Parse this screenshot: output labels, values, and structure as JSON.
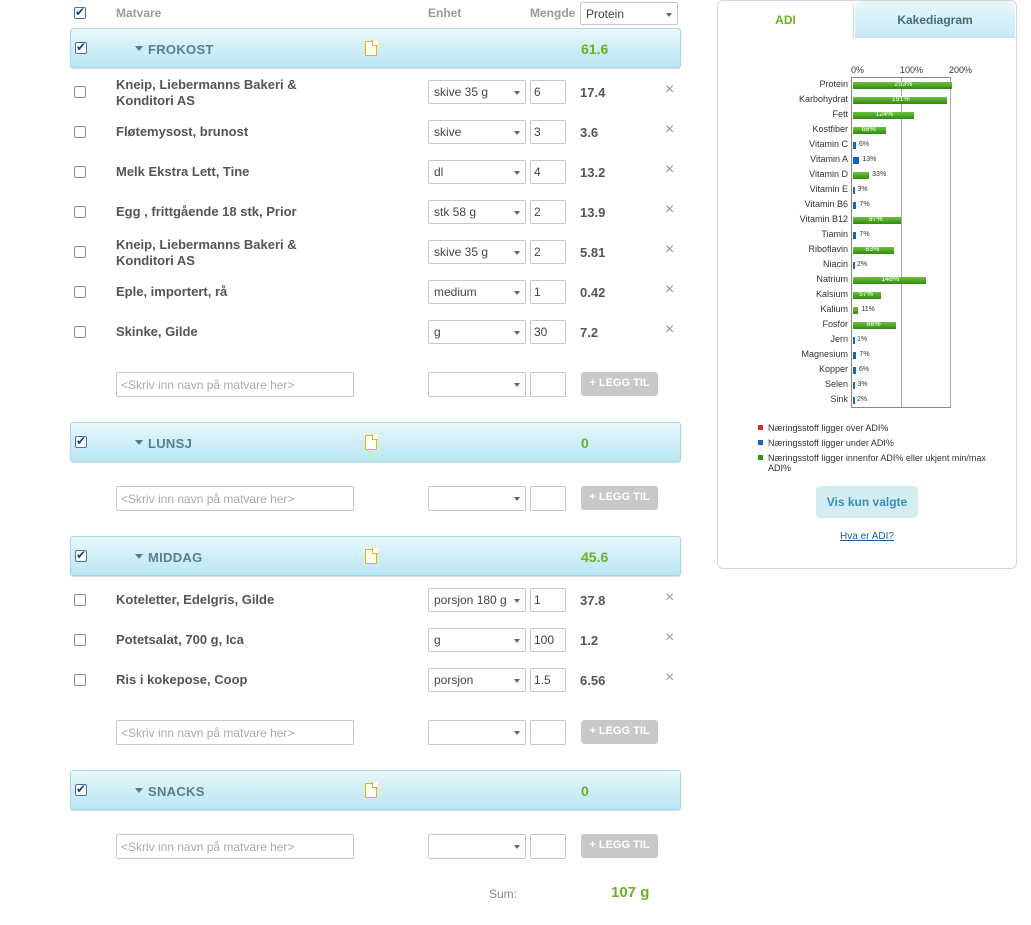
{
  "header": {
    "col_matvare": "Matvare",
    "col_enhet": "Enhet",
    "col_mengde": "Mengde",
    "nutrient_select": "Protein"
  },
  "meals": [
    {
      "name": "FROKOST",
      "total": "61.6",
      "items": [
        {
          "name": "Kneip, Liebermanns Bakeri & Konditori AS",
          "unit": "skive 35 g",
          "qty": "6",
          "value": "17.4"
        },
        {
          "name": "Fløtemysost, brunost",
          "unit": "skive",
          "qty": "3",
          "value": "3.6"
        },
        {
          "name": "Melk Ekstra Lett, Tine",
          "unit": "dl",
          "qty": "4",
          "value": "13.2"
        },
        {
          "name": "Egg , frittgående 18 stk, Prior",
          "unit": "stk 58 g",
          "qty": "2",
          "value": "13.9"
        },
        {
          "name": "Kneip, Liebermanns Bakeri & Konditori AS",
          "unit": "skive 35 g",
          "qty": "2",
          "value": "5.81"
        },
        {
          "name": "Eple, importert, rå",
          "unit": "medium",
          "qty": "1",
          "value": "0.42"
        },
        {
          "name": "Skinke, Gilde",
          "unit": "g",
          "qty": "30",
          "value": "7.2"
        }
      ]
    },
    {
      "name": "LUNSJ",
      "total": "0",
      "items": []
    },
    {
      "name": "MIDDAG",
      "total": "45.6",
      "items": [
        {
          "name": "Koteletter, Edelgris, Gilde",
          "unit": "porsjon 180 g",
          "qty": "1",
          "value": "37.8"
        },
        {
          "name": "Potetsalat, 700 g, Ica",
          "unit": "g",
          "qty": "100",
          "value": "1.2"
        },
        {
          "name": "Ris i kokepose, Coop",
          "unit": "porsjon",
          "qty": "1.5",
          "value": "6.56"
        }
      ]
    },
    {
      "name": "SNACKS",
      "total": "0",
      "items": []
    }
  ],
  "add_row": {
    "placeholder": "<Skriv inn navn på matvare her>",
    "button": "+ LEGG TIL"
  },
  "sum": {
    "label": "Sum:",
    "value": "107 g"
  },
  "panel": {
    "tab_adi": "ADI",
    "tab_kake": "Kakediagram",
    "btn_vis": "Vis kun valgte",
    "link_hva": "Hva er ADI?"
  },
  "chart_data": {
    "type": "bar",
    "orientation": "horizontal",
    "xticks": [
      "0%",
      "100%",
      "200%"
    ],
    "xlim": [
      0,
      260
    ],
    "categories": [
      "Protein",
      "Karbohydrat",
      "Fett",
      "Kostfiber",
      "Vitamin C",
      "Vitamin A",
      "Vitamin D",
      "Vitamin E",
      "Vitamin B6",
      "Vitamin B12",
      "Tiamin",
      "Riboflavin",
      "Niacin",
      "Natrium",
      "Kalsium",
      "Kalium",
      "Fosfor",
      "Jern",
      "Magnesium",
      "Kopper",
      "Selen",
      "Sink"
    ],
    "values": [
      253,
      191,
      124,
      68,
      6,
      13,
      33,
      3,
      7,
      97,
      7,
      83,
      2,
      148,
      57,
      11,
      88,
      1,
      7,
      6,
      3,
      2
    ],
    "colors": [
      "green",
      "green",
      "green",
      "green",
      "blue",
      "blue",
      "green",
      "blue",
      "blue",
      "green",
      "blue",
      "green",
      "blue",
      "green",
      "green",
      "green",
      "green",
      "blue",
      "blue",
      "blue",
      "blue",
      "blue"
    ],
    "legend": [
      {
        "color": "#d32f2f",
        "label": "Næringsstoff ligger over ADI%"
      },
      {
        "color": "#1565c0",
        "label": "Næringsstoff ligger under ADI%"
      },
      {
        "color": "#2e9a14",
        "label": "Næringsstoff ligger innenfor ADI% eller ukjent min/max ADI%"
      }
    ],
    "legend_position": "bottom"
  }
}
